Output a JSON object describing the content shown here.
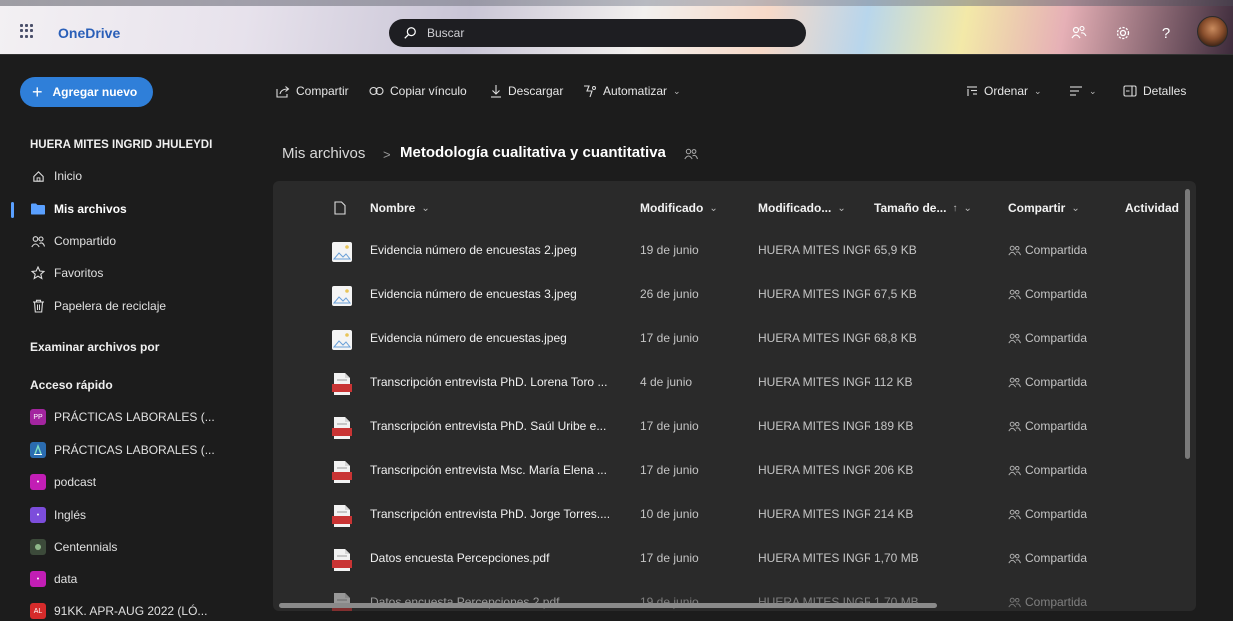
{
  "app": {
    "name": "OneDrive"
  },
  "search": {
    "placeholder": "Buscar"
  },
  "sidebar": {
    "add_button": "Agregar nuevo",
    "user_name": "HUERA MITES INGRID JHULEYDI",
    "nav": [
      {
        "label": "Inicio",
        "icon": "home-icon"
      },
      {
        "label": "Mis archivos",
        "icon": "folder-icon",
        "active": true
      },
      {
        "label": "Compartido",
        "icon": "people-icon"
      },
      {
        "label": "Favoritos",
        "icon": "star-icon"
      },
      {
        "label": "Papelera de reciclaje",
        "icon": "trash-icon"
      }
    ],
    "browse_heading": "Examinar archivos por",
    "quick_access_heading": "Acceso rápido",
    "quick_access": [
      {
        "label": "PRÁCTICAS LABORALES (...",
        "badge": "PP",
        "color": "#a3259f"
      },
      {
        "label": "PRÁCTICAS LABORALES (...",
        "badge": "",
        "color": "#2b6cb0"
      },
      {
        "label": "podcast",
        "badge": "",
        "color": "#c21eb5"
      },
      {
        "label": "Inglés",
        "badge": "",
        "color": "#7c4ddb"
      },
      {
        "label": "Centennials",
        "badge": "",
        "color": "#3c4a3a"
      },
      {
        "label": "data",
        "badge": "",
        "color": "#c21eb5"
      },
      {
        "label": "91KK. APR-AUG 2022 (LÓ...",
        "badge": "",
        "color": "#d62b2b"
      }
    ]
  },
  "commands": {
    "share": "Compartir",
    "copy_link": "Copiar vínculo",
    "download": "Descargar",
    "automate": "Automatizar",
    "sort": "Ordenar",
    "details": "Detalles"
  },
  "breadcrumb": {
    "root": "Mis archivos",
    "separator": ">",
    "current": "Metodología cualitativa y cuantitativa"
  },
  "table": {
    "columns": {
      "name": "Nombre",
      "modified": "Modificado",
      "modified_by": "Modificado...",
      "size": "Tamaño de...",
      "sharing": "Compartir",
      "activity": "Actividad"
    },
    "rows": [
      {
        "name": "Evidencia número de encuestas 2.jpeg",
        "type": "image",
        "modified": "19 de junio",
        "modified_by": "HUERA MITES INGRID",
        "size": "65,9 KB",
        "sharing": "Compartida"
      },
      {
        "name": "Evidencia número de encuestas 3.jpeg",
        "type": "image",
        "modified": "26 de junio",
        "modified_by": "HUERA MITES INGRID",
        "size": "67,5 KB",
        "sharing": "Compartida"
      },
      {
        "name": "Evidencia número de encuestas.jpeg",
        "type": "image",
        "modified": "17 de junio",
        "modified_by": "HUERA MITES INGRID",
        "size": "68,8 KB",
        "sharing": "Compartida"
      },
      {
        "name": "Transcripción entrevista PhD. Lorena Toro ...",
        "type": "pdf",
        "modified": "4 de junio",
        "modified_by": "HUERA MITES INGRID",
        "size": "112 KB",
        "sharing": "Compartida"
      },
      {
        "name": "Transcripción entrevista PhD. Saúl Uribe e...",
        "type": "pdf",
        "modified": "17 de junio",
        "modified_by": "HUERA MITES INGRID",
        "size": "189 KB",
        "sharing": "Compartida"
      },
      {
        "name": "Transcripción entrevista Msc. María Elena ...",
        "type": "pdf",
        "modified": "17 de junio",
        "modified_by": "HUERA MITES INGRID",
        "size": "206 KB",
        "sharing": "Compartida"
      },
      {
        "name": "Transcripción entrevista PhD. Jorge Torres....",
        "type": "pdf",
        "modified": "10 de junio",
        "modified_by": "HUERA MITES INGRID",
        "size": "214 KB",
        "sharing": "Compartida"
      },
      {
        "name": "Datos encuesta Percepciones.pdf",
        "type": "pdf",
        "modified": "17 de junio",
        "modified_by": "HUERA MITES INGRID",
        "size": "1,70 MB",
        "sharing": "Compartida"
      },
      {
        "name": "Datos encuesta Percepciones 2.pdf",
        "type": "pdf",
        "modified": "19 de junio",
        "modified_by": "HUERA MITES INGRID",
        "size": "1,70 MB",
        "sharing": "Compartida"
      }
    ]
  }
}
